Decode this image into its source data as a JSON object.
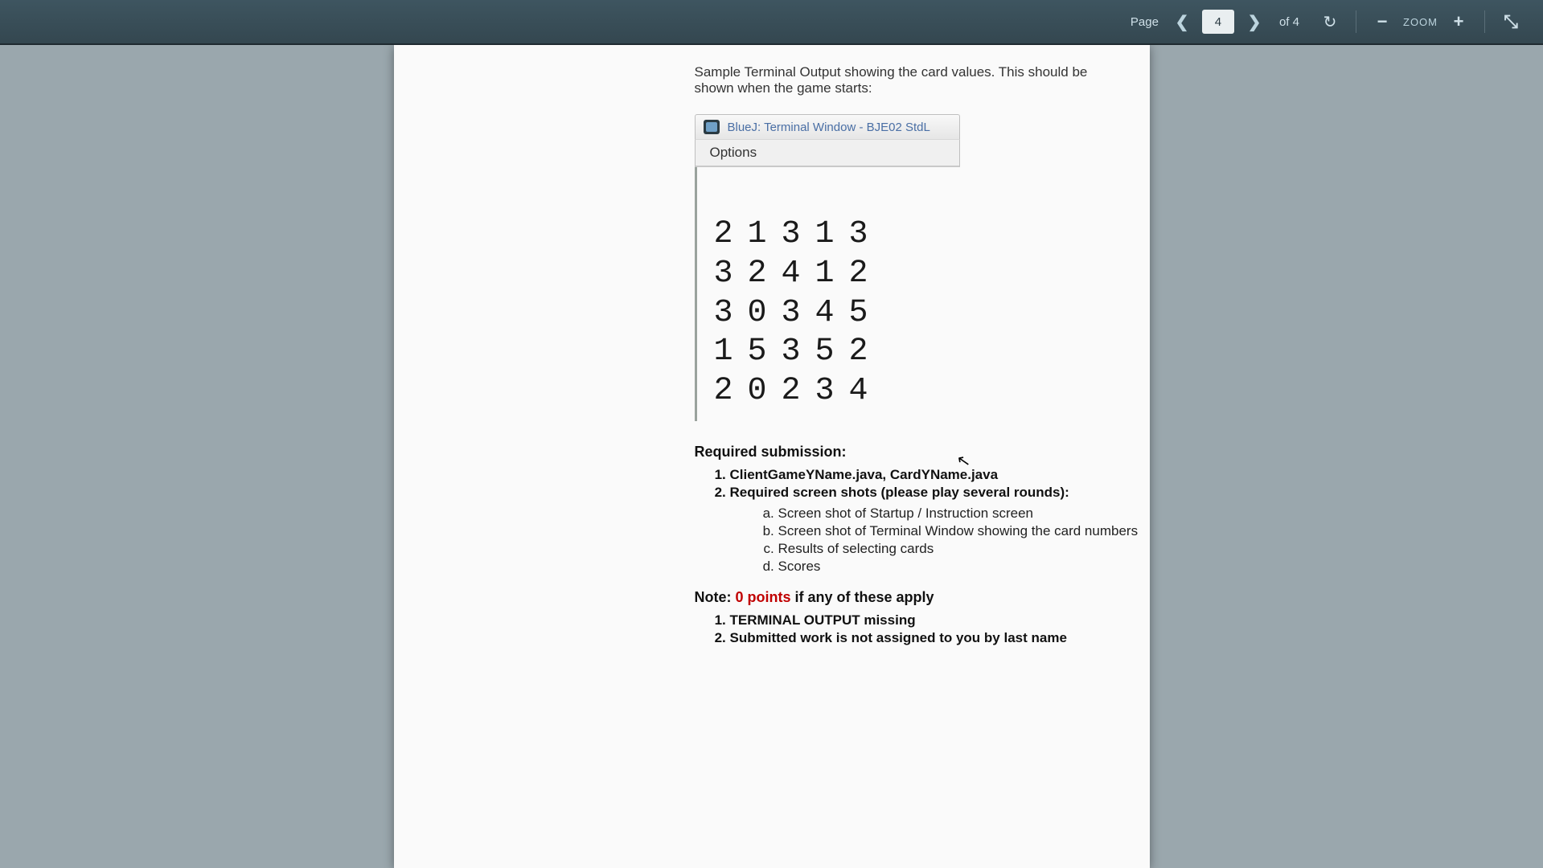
{
  "toolbar": {
    "page_label": "Page",
    "page_value": "4",
    "of_text": "of 4",
    "zoom_label": "ZOOM"
  },
  "doc": {
    "intro": "Sample Terminal Output showing the card values. This should be shown when the game starts:",
    "terminal": {
      "title": "BlueJ: Terminal Window - BJE02 StdL",
      "menu": "Options",
      "rows": [
        [
          "2",
          "1",
          "3",
          "1",
          "3"
        ],
        [
          "3",
          "2",
          "4",
          "1",
          "2"
        ],
        [
          "3",
          "0",
          "3",
          "4",
          "5"
        ],
        [
          "1",
          "5",
          "3",
          "5",
          "2"
        ],
        [
          "2",
          "0",
          "2",
          "3",
          "4"
        ]
      ]
    },
    "req_heading": "Required submission:",
    "req_items": [
      "ClientGameYName.java,  CardYName.java",
      "Required screen shots (please play several rounds):"
    ],
    "sub_items": [
      "Screen shot of Startup / Instruction screen",
      "Screen shot of Terminal Window showing the card numbers",
      "Results of selecting cards",
      "Scores"
    ],
    "note_label": "Note",
    "note_colon": ": ",
    "note_zero": "0 points",
    "note_rest": " if any of these apply",
    "penalty_items": [
      "TERMINAL OUTPUT missing",
      "Submitted work is not assigned to you by last name"
    ]
  }
}
